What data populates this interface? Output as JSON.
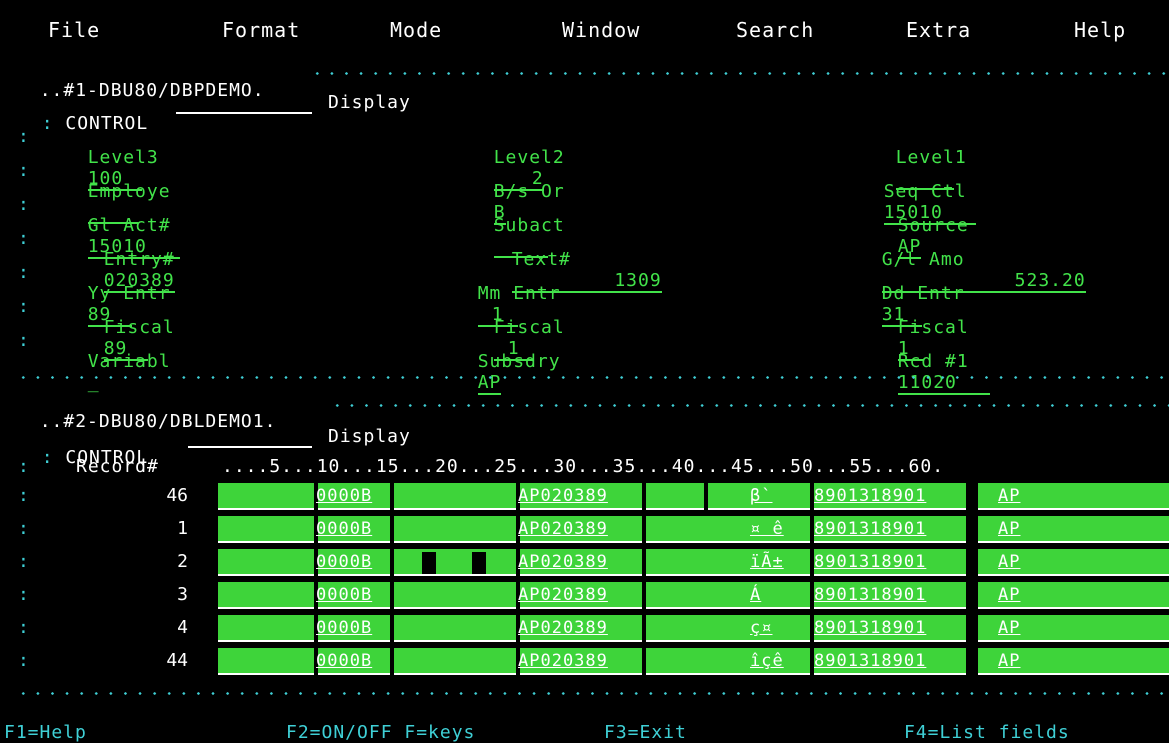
{
  "menu": [
    "File",
    "Format",
    "Mode",
    "Window",
    "Search",
    "Extra",
    "Help"
  ],
  "panel1": {
    "title": "..#1-DBU80/DBPDEMO.",
    "control_label": "CONTROL",
    "control_mode": "Display",
    "fields": [
      {
        "label": "Level3",
        "value": "100"
      },
      {
        "label": "Level2",
        "value": "2"
      },
      {
        "label": "Level1",
        "value": ""
      },
      {
        "label": "Employe",
        "value": ""
      },
      {
        "label": "B/s Or",
        "value": "B"
      },
      {
        "label": "Seq Ctl",
        "value": "15010"
      },
      {
        "label": "Gl Act#",
        "value": "15010"
      },
      {
        "label": "Subact",
        "value": ""
      },
      {
        "label": "Source",
        "value": "AP"
      },
      {
        "label": "Entry#",
        "value": "020389"
      },
      {
        "label": "Text#",
        "value": "1309"
      },
      {
        "label": "G/l Amo",
        "value": "523.20"
      },
      {
        "label": "Yy Entr",
        "value": "89"
      },
      {
        "label": "Mm Entr",
        "value": "1"
      },
      {
        "label": "Dd Entr",
        "value": "31"
      },
      {
        "label": "Fiscal",
        "value": "89"
      },
      {
        "label": "Fiscal",
        "value": "1"
      },
      {
        "label": "Fiscal",
        "value": "1"
      },
      {
        "label": "Variabl",
        "value": "_"
      },
      {
        "label": "Subsdry",
        "value": "AP"
      },
      {
        "label": "Rcd #1",
        "value": "11020"
      }
    ]
  },
  "panel2": {
    "title": "..#2-DBU80/DBLDEMO1.",
    "control_label": "CONTROL",
    "control_mode": "Display",
    "record_header": "Record#",
    "ruler": "....5...10...15...20...25...30...35...40...45...50...55...60.",
    "records": [
      {
        "num": "46",
        "a": "0000B",
        "b": "AP020389",
        "c": "β`",
        "d": "8901318901",
        "e": "AP"
      },
      {
        "num": "1",
        "a": "0000B",
        "b": "AP020389",
        "c": "¤ ê",
        "d": "8901318901",
        "e": "AP"
      },
      {
        "num": "2",
        "a": "0000B",
        "b": "AP020389",
        "c": "ïÃ±",
        "d": "8901318901",
        "e": "AP"
      },
      {
        "num": "3",
        "a": "0000B",
        "b": "AP020389",
        "c": "Á",
        "d": "8901318901",
        "e": "AP"
      },
      {
        "num": "4",
        "a": "0000B",
        "b": "AP020389",
        "c": "ç¤",
        "d": "8901318901",
        "e": "AP"
      },
      {
        "num": "44",
        "a": "0000B",
        "b": "AP020389",
        "c": "îçê",
        "d": "8901318901",
        "e": "AP"
      }
    ]
  },
  "fkeys": {
    "f1": "F1=Help",
    "f2": "F2=ON/OFF F=keys",
    "f3": "F3=Exit",
    "f4": "F4=List fields"
  }
}
